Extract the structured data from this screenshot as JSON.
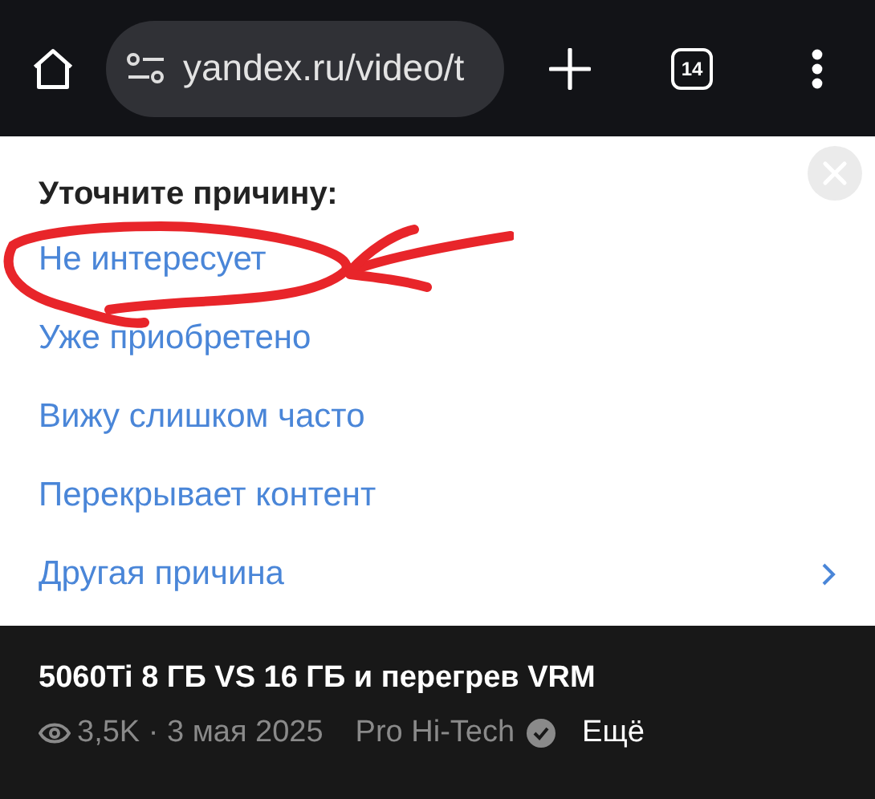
{
  "browser_bar": {
    "url": "yandex.ru/video/t",
    "tab_count": "14"
  },
  "dialog": {
    "title": "Уточните причину:",
    "reasons": [
      {
        "label": "Не интересует",
        "kind": "plain",
        "circled": true
      },
      {
        "label": "Уже приобретено",
        "kind": "plain",
        "circled": false
      },
      {
        "label": "Вижу слишком часто",
        "kind": "plain",
        "circled": false
      },
      {
        "label": "Перекрывает контент",
        "kind": "plain",
        "circled": false
      },
      {
        "label": "Другая причина",
        "kind": "submenu",
        "circled": false
      }
    ]
  },
  "video": {
    "title": "5060Ti 8 ГБ VS 16 ГБ и перегрев VRM",
    "stats": "3,5K · 3 мая 2025",
    "channel": "Pro Hi-Tech",
    "verified": true,
    "more": "Ещё"
  }
}
